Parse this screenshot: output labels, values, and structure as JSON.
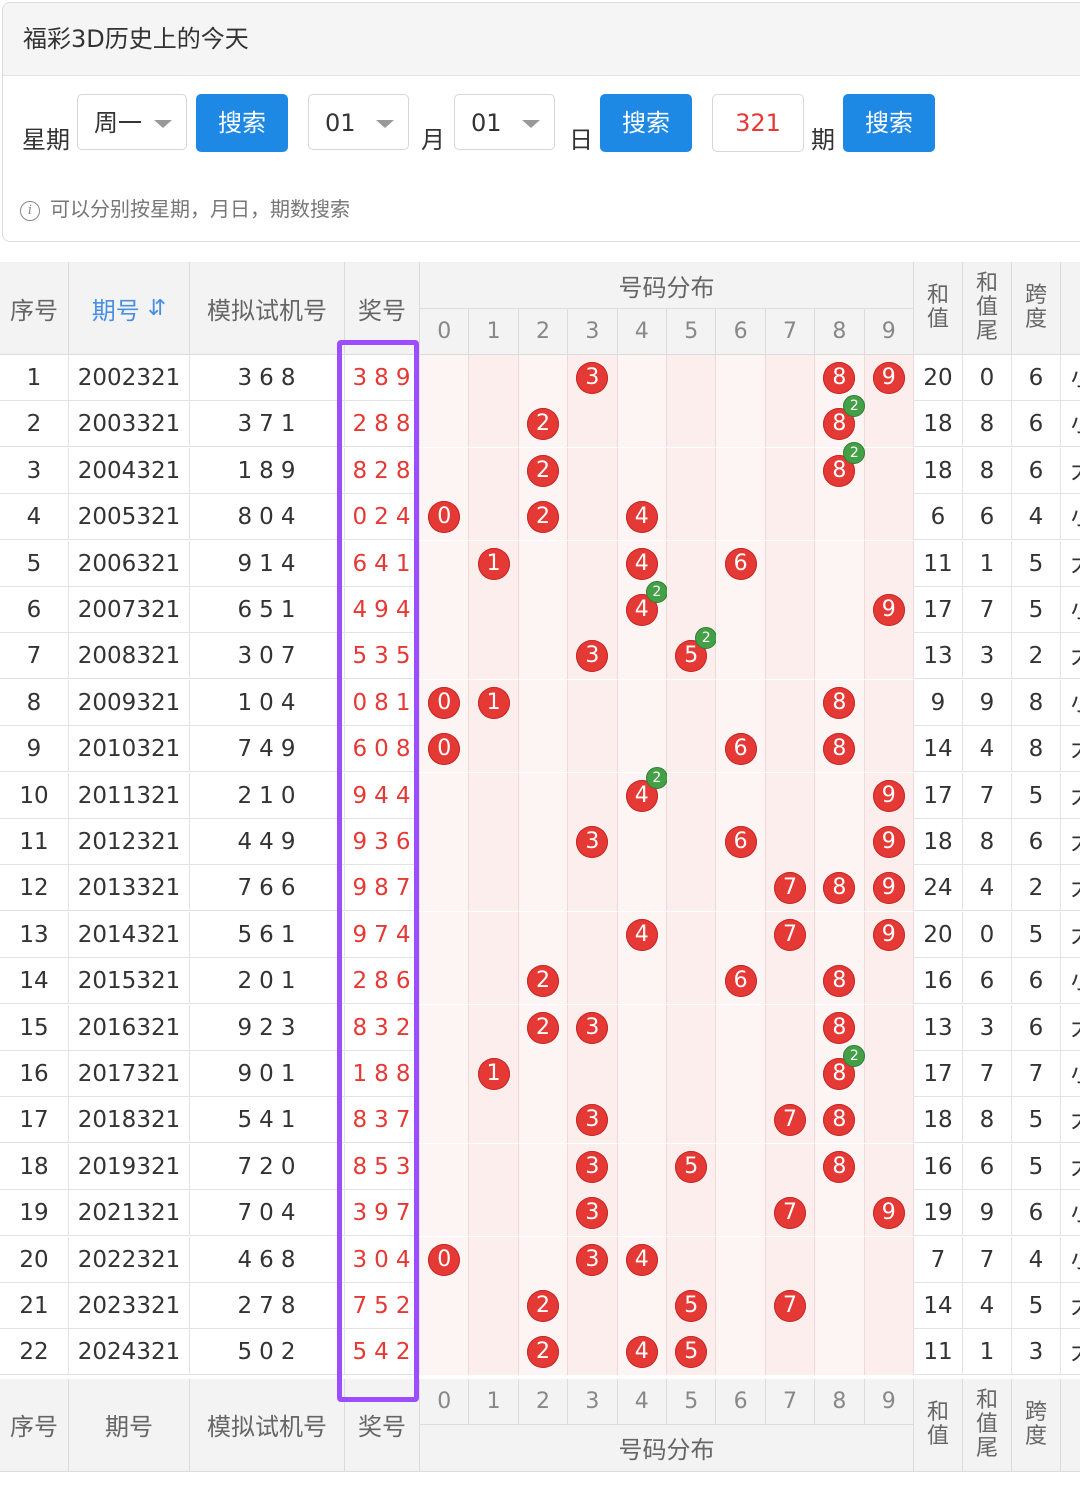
{
  "header": {
    "title": "福彩3D历史上的今天"
  },
  "search": {
    "weekday_label": "星期",
    "weekday_value": "周一",
    "search_label": "搜索",
    "month_value": "01",
    "month_label": "月",
    "day_value": "01",
    "day_label": "日",
    "issue_value": "321",
    "issue_label": "期",
    "hint_icon": "i",
    "hint": "可以分别按星期，月日，期数搜索"
  },
  "table": {
    "headers": {
      "index": "序号",
      "issue": "期号",
      "sort_icon": "⇵",
      "sim": "模拟试机号",
      "prize": "奖号",
      "dist": "号码分布",
      "sum": "和值",
      "tail": "和值尾",
      "span": "跨度"
    },
    "digits": [
      "0",
      "1",
      "2",
      "3",
      "4",
      "5",
      "6",
      "7",
      "8",
      "9"
    ],
    "rows": [
      {
        "idx": "1",
        "issue": "2002321",
        "sim": "368",
        "prize": "389",
        "sum": "20",
        "tail": "0",
        "span": "6",
        "extra": "小",
        "balls": [
          3,
          8,
          9
        ],
        "repeat": {}
      },
      {
        "idx": "2",
        "issue": "2003321",
        "sim": "371",
        "prize": "288",
        "sum": "18",
        "tail": "8",
        "span": "6",
        "extra": "小",
        "balls": [
          2,
          8
        ],
        "repeat": {
          "8": "2"
        }
      },
      {
        "idx": "3",
        "issue": "2004321",
        "sim": "189",
        "prize": "828",
        "sum": "18",
        "tail": "8",
        "span": "6",
        "extra": "大",
        "balls": [
          2,
          8
        ],
        "repeat": {
          "8": "2"
        }
      },
      {
        "idx": "4",
        "issue": "2005321",
        "sim": "804",
        "prize": "024",
        "sum": "6",
        "tail": "6",
        "span": "4",
        "extra": "小",
        "balls": [
          0,
          2,
          4
        ],
        "repeat": {}
      },
      {
        "idx": "5",
        "issue": "2006321",
        "sim": "914",
        "prize": "641",
        "sum": "11",
        "tail": "1",
        "span": "5",
        "extra": "大",
        "balls": [
          1,
          4,
          6
        ],
        "repeat": {}
      },
      {
        "idx": "6",
        "issue": "2007321",
        "sim": "651",
        "prize": "494",
        "sum": "17",
        "tail": "7",
        "span": "5",
        "extra": "小",
        "balls": [
          4,
          9
        ],
        "repeat": {
          "4": "2"
        }
      },
      {
        "idx": "7",
        "issue": "2008321",
        "sim": "307",
        "prize": "535",
        "sum": "13",
        "tail": "3",
        "span": "2",
        "extra": "大",
        "balls": [
          3,
          5
        ],
        "repeat": {
          "5": "2"
        }
      },
      {
        "idx": "8",
        "issue": "2009321",
        "sim": "104",
        "prize": "081",
        "sum": "9",
        "tail": "9",
        "span": "8",
        "extra": "小",
        "balls": [
          0,
          1,
          8
        ],
        "repeat": {}
      },
      {
        "idx": "9",
        "issue": "2010321",
        "sim": "749",
        "prize": "608",
        "sum": "14",
        "tail": "4",
        "span": "8",
        "extra": "大",
        "balls": [
          0,
          6,
          8
        ],
        "repeat": {}
      },
      {
        "idx": "10",
        "issue": "2011321",
        "sim": "210",
        "prize": "944",
        "sum": "17",
        "tail": "7",
        "span": "5",
        "extra": "大",
        "balls": [
          4,
          9
        ],
        "repeat": {
          "4": "2"
        }
      },
      {
        "idx": "11",
        "issue": "2012321",
        "sim": "449",
        "prize": "936",
        "sum": "18",
        "tail": "8",
        "span": "6",
        "extra": "大",
        "balls": [
          3,
          6,
          9
        ],
        "repeat": {}
      },
      {
        "idx": "12",
        "issue": "2013321",
        "sim": "766",
        "prize": "987",
        "sum": "24",
        "tail": "4",
        "span": "2",
        "extra": "大",
        "balls": [
          7,
          8,
          9
        ],
        "repeat": {}
      },
      {
        "idx": "13",
        "issue": "2014321",
        "sim": "561",
        "prize": "974",
        "sum": "20",
        "tail": "0",
        "span": "5",
        "extra": "大",
        "balls": [
          4,
          7,
          9
        ],
        "repeat": {}
      },
      {
        "idx": "14",
        "issue": "2015321",
        "sim": "201",
        "prize": "286",
        "sum": "16",
        "tail": "6",
        "span": "6",
        "extra": "小",
        "balls": [
          2,
          6,
          8
        ],
        "repeat": {}
      },
      {
        "idx": "15",
        "issue": "2016321",
        "sim": "923",
        "prize": "832",
        "sum": "13",
        "tail": "3",
        "span": "6",
        "extra": "大",
        "balls": [
          2,
          3,
          8
        ],
        "repeat": {}
      },
      {
        "idx": "16",
        "issue": "2017321",
        "sim": "901",
        "prize": "188",
        "sum": "17",
        "tail": "7",
        "span": "7",
        "extra": "小",
        "balls": [
          1,
          8
        ],
        "repeat": {
          "8": "2"
        }
      },
      {
        "idx": "17",
        "issue": "2018321",
        "sim": "541",
        "prize": "837",
        "sum": "18",
        "tail": "8",
        "span": "5",
        "extra": "大",
        "balls": [
          3,
          7,
          8
        ],
        "repeat": {}
      },
      {
        "idx": "18",
        "issue": "2019321",
        "sim": "720",
        "prize": "853",
        "sum": "16",
        "tail": "6",
        "span": "5",
        "extra": "大",
        "balls": [
          3,
          5,
          8
        ],
        "repeat": {}
      },
      {
        "idx": "19",
        "issue": "2021321",
        "sim": "704",
        "prize": "397",
        "sum": "19",
        "tail": "9",
        "span": "6",
        "extra": "小",
        "balls": [
          3,
          7,
          9
        ],
        "repeat": {}
      },
      {
        "idx": "20",
        "issue": "2022321",
        "sim": "468",
        "prize": "304",
        "sum": "7",
        "tail": "7",
        "span": "4",
        "extra": "小",
        "balls": [
          0,
          3,
          4
        ],
        "repeat": {}
      },
      {
        "idx": "21",
        "issue": "2023321",
        "sim": "278",
        "prize": "752",
        "sum": "14",
        "tail": "4",
        "span": "5",
        "extra": "大",
        "balls": [
          2,
          5,
          7
        ],
        "repeat": {}
      },
      {
        "idx": "22",
        "issue": "2024321",
        "sim": "502",
        "prize": "542",
        "sum": "11",
        "tail": "1",
        "span": "3",
        "extra": "大",
        "balls": [
          2,
          4,
          5
        ],
        "repeat": {}
      }
    ]
  },
  "colors": {
    "accent": "#1e88e5",
    "ball": "#e53935",
    "repeat_badge": "#43a047",
    "highlight_box": "#9c4dff"
  }
}
